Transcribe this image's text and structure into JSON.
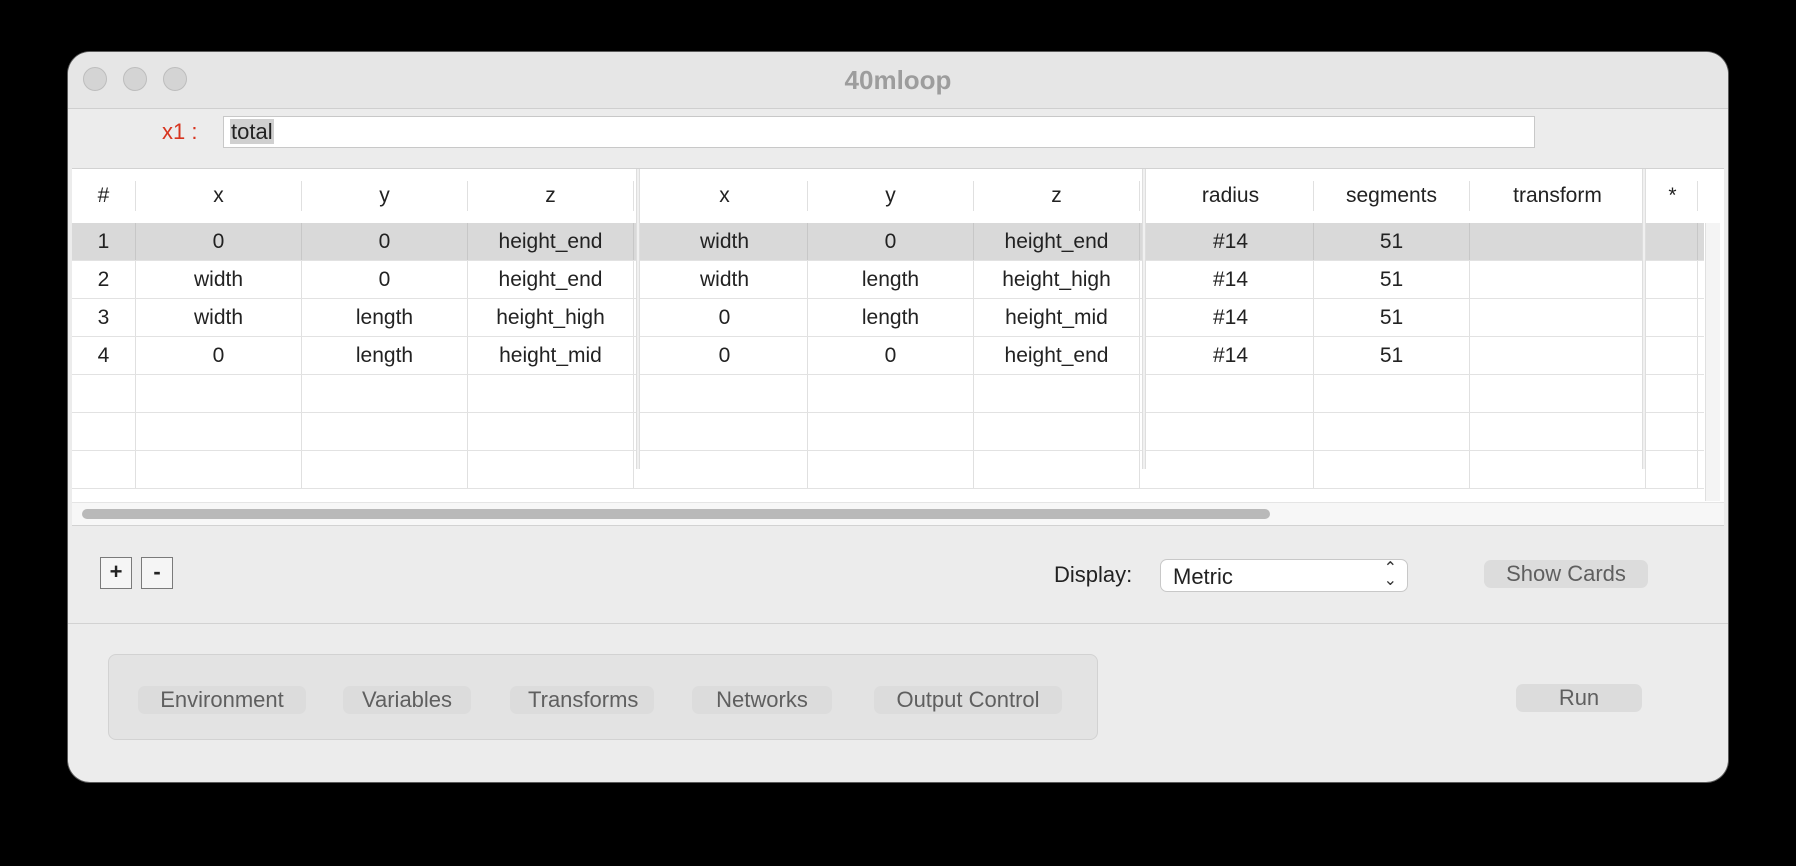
{
  "window": {
    "title": "40mloop"
  },
  "expression": {
    "label": "x1 :",
    "value": "total"
  },
  "table": {
    "headers": [
      "#",
      "x",
      "y",
      "z",
      "x",
      "y",
      "z",
      "radius",
      "segments",
      "transform",
      "*"
    ],
    "rows": [
      [
        "1",
        "0",
        "0",
        "height_end",
        "width",
        "0",
        "height_end",
        "#14",
        "51",
        "",
        ""
      ],
      [
        "2",
        "width",
        "0",
        "height_end",
        "width",
        "length",
        "height_high",
        "#14",
        "51",
        "",
        ""
      ],
      [
        "3",
        "width",
        "length",
        "height_high",
        "0",
        "length",
        "height_mid",
        "#14",
        "51",
        "",
        ""
      ],
      [
        "4",
        "0",
        "length",
        "height_mid",
        "0",
        "0",
        "height_end",
        "#14",
        "51",
        "",
        ""
      ]
    ],
    "empty_rows": 3,
    "selected_row": 0
  },
  "controls": {
    "add_label": "+",
    "remove_label": "-",
    "display_label": "Display:",
    "display_value": "Metric",
    "show_cards_label": "Show Cards"
  },
  "bottom": {
    "buttons": [
      "Environment",
      "Variables",
      "Transforms",
      "Networks",
      "Output Control"
    ],
    "run_label": "Run"
  }
}
